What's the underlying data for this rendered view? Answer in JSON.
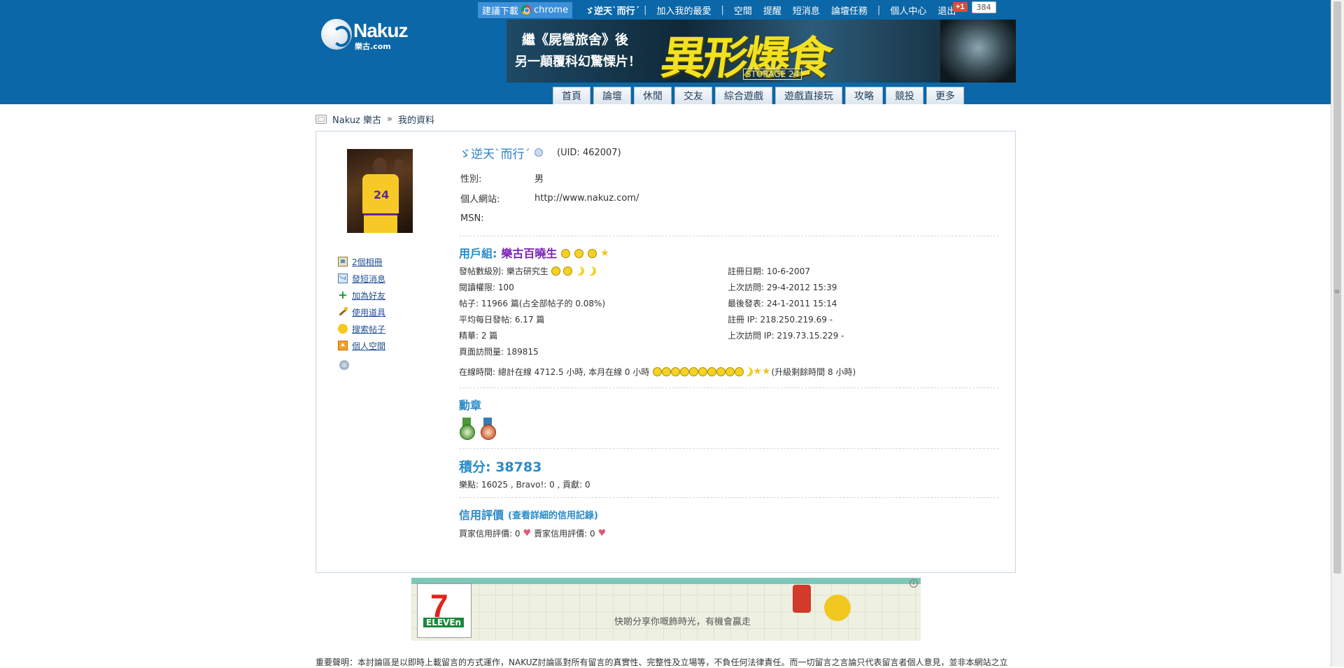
{
  "topbar": {
    "download_label": "建議下載",
    "chrome_label": "chrome",
    "username": "ゞ逆天ˋ而行ˊ",
    "links": [
      "加入我的最愛",
      "空間",
      "提醒",
      "短消息",
      "論壇任務",
      "個人中心",
      "退出"
    ],
    "gplus_label": "+1",
    "gplus_count": "384"
  },
  "logo": {
    "name": "Nakuz",
    "sub": "樂古.com"
  },
  "banner": {
    "line1": "繼《屍營旅舍》後",
    "line2": "另一顛覆科幻驚慄片！",
    "title": "異形爆食",
    "badge": "STORAGE 24"
  },
  "nav": [
    "首頁",
    "論壇",
    "休閒",
    "交友",
    "綜合遊戲",
    "遊戲直接玩",
    "攻略",
    "競投",
    "更多"
  ],
  "breadcrumb": {
    "home": "Nakuz 樂古",
    "sep": "»",
    "current": "我的資料"
  },
  "sidebar_actions": [
    {
      "label": "2個相冊",
      "icon": "album-icon"
    },
    {
      "label": "發短消息",
      "icon": "mail-icon"
    },
    {
      "label": "加為好友",
      "icon": "add-friend-icon"
    },
    {
      "label": "使用道具",
      "icon": "magic-wand-icon"
    },
    {
      "label": "搜索帖子",
      "icon": "speech-bubble-icon"
    },
    {
      "label": "個人空間",
      "icon": "home-icon"
    }
  ],
  "profile": {
    "name": "ゞ逆天ˋ而行ˊ",
    "uid": "(UID: 462007)",
    "gender_label": "性別:",
    "gender": "男",
    "website_label": "個人網站:",
    "website": "http://www.nakuz.com/",
    "msn_label": "MSN:",
    "msn": ""
  },
  "usergroup": {
    "label": "用戶組:",
    "name": "樂古百曉生"
  },
  "stats_left": [
    "發帖數級別: 樂古研究生",
    "閱讀權限: 100",
    "帖子: 11966 篇(占全部帖子的 0.08%)",
    "平均每日發帖: 6.17 篇",
    "精華: 2 篇",
    "頁面訪問量: 189815"
  ],
  "stats_right": [
    "註冊日期: 10-6-2007",
    "上次訪問: 29-4-2012 15:39",
    "最後發表: 24-1-2011 15:14",
    "註冊 IP: 218.250.219.69 -",
    "上次訪問 IP: 219.73.15.229 -"
  ],
  "online": {
    "text": "在線時間: 總計在線 4712.5 小時, 本月在線 0 小時",
    "upgrade": "(升級剩餘時間 8 小時)"
  },
  "medals": {
    "title": "勳章"
  },
  "points": {
    "title": "積分: 38783",
    "detail": "樂點: 16025 , Bravo!: 0 , 貢獻: 0"
  },
  "credit": {
    "title": "信用評價",
    "link": "(查看詳細的信用記錄)",
    "buyer": "買家信用評價: 0",
    "seller": "賣家信用評價: 0"
  },
  "ad": {
    "brand": "7",
    "brand_sub": "ELEVEn",
    "slogan": "快啲分享你嘅飾時光，有機會贏走"
  },
  "footer": "重要聲明：本討論區是以即時上載留言的方式運作，NAKUZ討論區對所有留言的真實性、完整性及立場等，不負任何法律責任。而一切留言之言論只代表留言者個人意見，並非本網站之立",
  "colors": {
    "header_bg": "#0b67a7",
    "accent": "#2a8bc8",
    "usergroup": "#7b24b8"
  }
}
